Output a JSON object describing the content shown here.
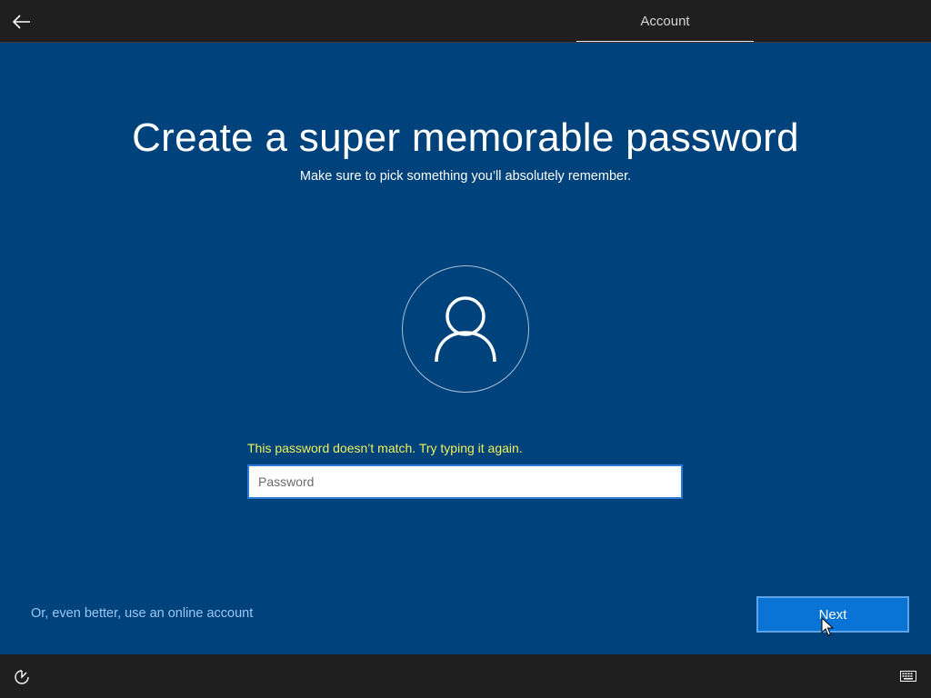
{
  "header": {
    "tab_label": "Account"
  },
  "main": {
    "title": "Create a super memorable password",
    "subtitle": "Make sure to pick something you’ll absolutely remember.",
    "error_message": "This password doesn’t match. Try typing it again.",
    "password_field": {
      "value": "",
      "placeholder": "Password"
    },
    "online_account_link": "Or, even better, use an online account",
    "next_label": "Next"
  },
  "icons": {
    "back": "back-arrow-icon",
    "avatar": "user-icon",
    "ease_of_access": "ease-of-access-icon",
    "keyboard": "keyboard-icon"
  },
  "colors": {
    "background": "#00427b",
    "bar": "#1f1f1f",
    "error": "#f1f15a",
    "link": "#9cc7f4",
    "button": "#0a74d6"
  }
}
